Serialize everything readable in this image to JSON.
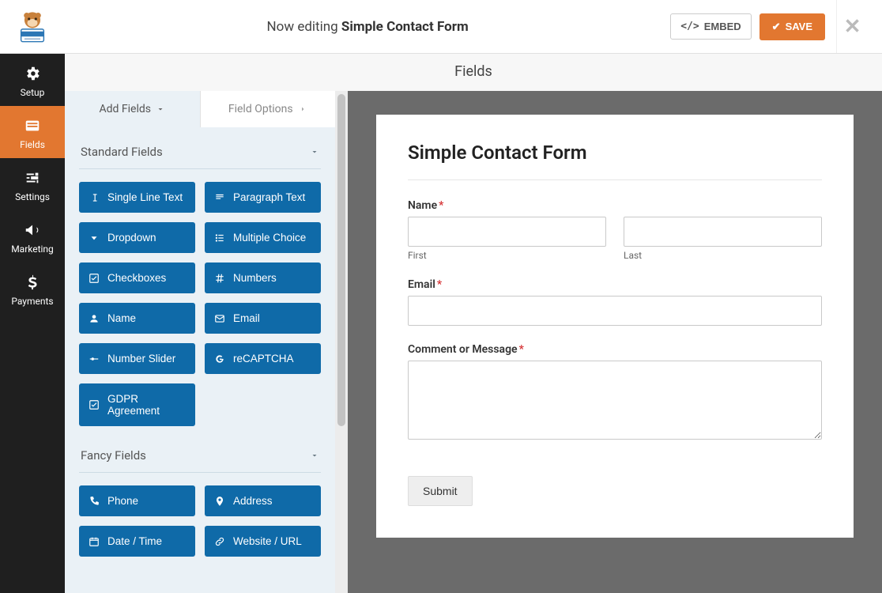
{
  "header": {
    "now_editing_prefix": "Now editing",
    "form_name": "Simple Contact Form",
    "embed_label": "EMBED",
    "save_label": "SAVE"
  },
  "nav": {
    "items": [
      {
        "id": "setup",
        "label": "Setup"
      },
      {
        "id": "fields",
        "label": "Fields"
      },
      {
        "id": "settings",
        "label": "Settings"
      },
      {
        "id": "marketing",
        "label": "Marketing"
      },
      {
        "id": "payments",
        "label": "Payments"
      }
    ]
  },
  "center": {
    "title": "Fields"
  },
  "panel": {
    "tabs": {
      "add": "Add Fields",
      "options": "Field Options"
    },
    "sections": {
      "standard": {
        "title": "Standard Fields",
        "fields": [
          "Single Line Text",
          "Paragraph Text",
          "Dropdown",
          "Multiple Choice",
          "Checkboxes",
          "Numbers",
          "Name",
          "Email",
          "Number Slider",
          "reCAPTCHA",
          "GDPR Agreement"
        ]
      },
      "fancy": {
        "title": "Fancy Fields",
        "fields": [
          "Phone",
          "Address",
          "Date / Time",
          "Website / URL"
        ]
      }
    }
  },
  "preview": {
    "form_title": "Simple Contact Form",
    "name_label": "Name",
    "first_sub": "First",
    "last_sub": "Last",
    "email_label": "Email",
    "comment_label": "Comment or Message",
    "submit_label": "Submit"
  }
}
